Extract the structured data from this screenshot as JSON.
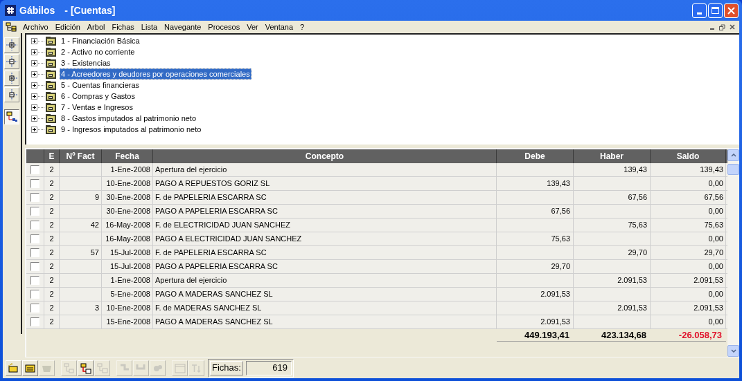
{
  "window": {
    "title": "Gábilos",
    "document": "- [Cuentas]"
  },
  "menu": [
    "Archivo",
    "Edición",
    "Arbol",
    "Fichas",
    "Lista",
    "Navegante",
    "Procesos",
    "Ver",
    "Ventana",
    "?"
  ],
  "left_toolbar": [
    {
      "pressed": false
    },
    {
      "pressed": false
    },
    {
      "pressed": false
    },
    {
      "pressed": false
    },
    {
      "pressed": true
    }
  ],
  "tree": [
    {
      "label": "1 - Financiación Básica",
      "selected": false
    },
    {
      "label": "2 - Activo no corriente",
      "selected": false
    },
    {
      "label": "3 - Existencias",
      "selected": false
    },
    {
      "label": "4 - Acreedores y deudores por operaciones comerciales",
      "selected": true
    },
    {
      "label": "5 - Cuentas financieras",
      "selected": false
    },
    {
      "label": "6 - Compras y Gastos",
      "selected": false
    },
    {
      "label": "7 - Ventas e Ingresos",
      "selected": false
    },
    {
      "label": "8 - Gastos imputados al patrimonio neto",
      "selected": false
    },
    {
      "label": "9 - Ingresos imputados al patrimonio neto",
      "selected": false
    }
  ],
  "table": {
    "columns": [
      "E",
      "Nº Fact",
      "Fecha",
      "Concepto",
      "Debe",
      "Haber",
      "Saldo"
    ],
    "rows": [
      {
        "checked": false,
        "e": "2",
        "fact": "",
        "fecha": "1-Ene-2008",
        "concepto": "Apertura del ejercicio",
        "debe": "",
        "haber": "139,43",
        "saldo": "139,43"
      },
      {
        "checked": false,
        "e": "2",
        "fact": "",
        "fecha": "10-Ene-2008",
        "concepto": "PAGO A REPUESTOS GORIZ SL",
        "debe": "139,43",
        "haber": "",
        "saldo": "0,00"
      },
      {
        "checked": false,
        "e": "2",
        "fact": "9",
        "fecha": "30-Ene-2008",
        "concepto": "F. de PAPELERIA ESCARRA SC",
        "debe": "",
        "haber": "67,56",
        "saldo": "67,56"
      },
      {
        "checked": false,
        "e": "2",
        "fact": "",
        "fecha": "30-Ene-2008",
        "concepto": "PAGO A PAPELERIA ESCARRA SC",
        "debe": "67,56",
        "haber": "",
        "saldo": "0,00"
      },
      {
        "checked": false,
        "e": "2",
        "fact": "42",
        "fecha": "16-May-2008",
        "concepto": "F. de ELECTRICIDAD JUAN SANCHEZ",
        "debe": "",
        "haber": "75,63",
        "saldo": "75,63"
      },
      {
        "checked": false,
        "e": "2",
        "fact": "",
        "fecha": "16-May-2008",
        "concepto": "PAGO A ELECTRICIDAD JUAN SANCHEZ",
        "debe": "75,63",
        "haber": "",
        "saldo": "0,00"
      },
      {
        "checked": false,
        "e": "2",
        "fact": "57",
        "fecha": "15-Jul-2008",
        "concepto": "F. de PAPELERIA ESCARRA SC",
        "debe": "",
        "haber": "29,70",
        "saldo": "29,70"
      },
      {
        "checked": false,
        "e": "2",
        "fact": "",
        "fecha": "15-Jul-2008",
        "concepto": "PAGO A PAPELERIA ESCARRA SC",
        "debe": "29,70",
        "haber": "",
        "saldo": "0,00"
      },
      {
        "checked": false,
        "e": "2",
        "fact": "",
        "fecha": "1-Ene-2008",
        "concepto": "Apertura del ejercicio",
        "debe": "",
        "haber": "2.091,53",
        "saldo": "2.091,53"
      },
      {
        "checked": false,
        "e": "2",
        "fact": "",
        "fecha": "5-Ene-2008",
        "concepto": "PAGO A MADERAS SANCHEZ SL",
        "debe": "2.091,53",
        "haber": "",
        "saldo": "0,00"
      },
      {
        "checked": false,
        "e": "2",
        "fact": "3",
        "fecha": "10-Ene-2008",
        "concepto": "F. de MADERAS SANCHEZ SL",
        "debe": "",
        "haber": "2.091,53",
        "saldo": "2.091,53"
      },
      {
        "checked": false,
        "e": "2",
        "fact": "",
        "fecha": "15-Ene-2008",
        "concepto": "PAGO A MADERAS SANCHEZ SL",
        "debe": "2.091,53",
        "haber": "",
        "saldo": "0,00"
      }
    ],
    "totals": {
      "debe": "449.193,41",
      "haber": "423.134,68",
      "saldo": "-26.058,73",
      "saldo_negative": true
    }
  },
  "bottom_toolbar": [
    {
      "disabled": false
    },
    {
      "disabled": false
    },
    {
      "disabled": true
    },
    {
      "disabled": true
    },
    {
      "disabled": false
    },
    {
      "disabled": true
    },
    {
      "disabled": true
    },
    {
      "disabled": true
    },
    {
      "disabled": true
    },
    {
      "disabled": true
    },
    {
      "disabled": true
    }
  ],
  "status": {
    "label": "Fichas:",
    "value": "619"
  }
}
